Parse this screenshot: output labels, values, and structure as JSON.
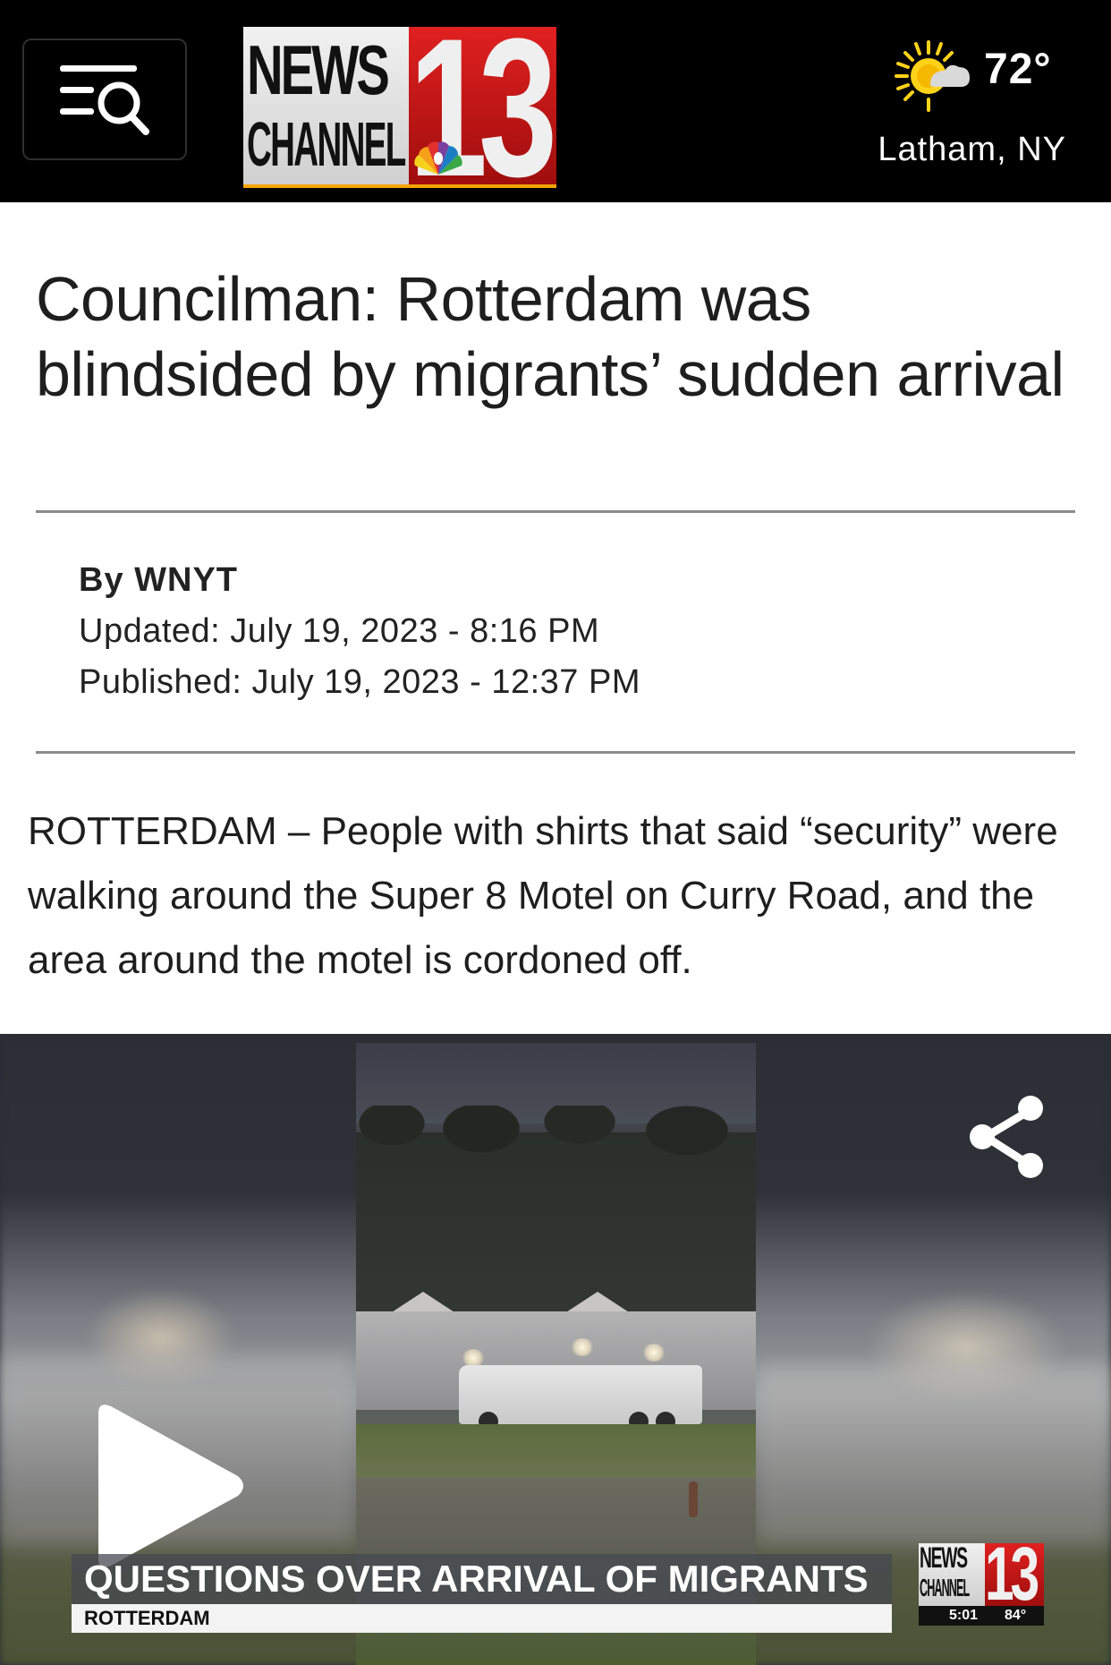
{
  "header": {
    "menu_icon": "menu-search-icon",
    "logo": {
      "line1": "NEWS",
      "line2": "CHANNEL",
      "number": "13",
      "colors": {
        "red": "#d41e1e",
        "gold": "#f2a400"
      }
    },
    "weather": {
      "icon": "partly-sunny-icon",
      "temperature": "72°",
      "location": "Latham, NY"
    }
  },
  "article": {
    "headline": "Councilman: Rotterdam was blindsided by migrants’ sudden arrival",
    "byline": "By WNYT",
    "updated": "Updated: July 19, 2023 - 8:16 PM",
    "published": "Published: July 19, 2023 - 12:37 PM",
    "lead": "ROTTERDAM – People with shirts that said “security” were walking around the Super 8 Motel on Curry Road, and the area around the motel is cordoned off."
  },
  "video": {
    "share_icon": "share-icon",
    "play_icon": "play-icon",
    "lower_third_title": "QUESTIONS OVER ARRIVAL OF MIGRANTS",
    "lower_third_subtitle": "ROTTERDAM",
    "bug": {
      "line1": "NEWS",
      "line2": "CHANNEL",
      "number": "13",
      "time": "5:01",
      "temp": "84°"
    }
  }
}
